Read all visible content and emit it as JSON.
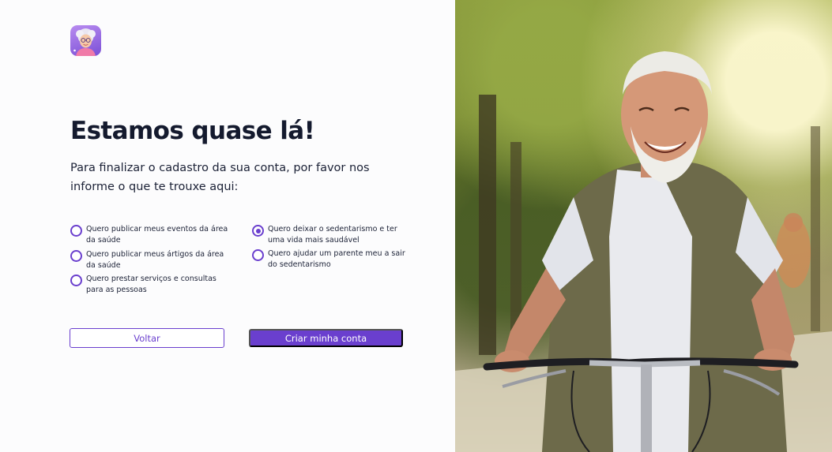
{
  "logo": {
    "icon": "elderly-woman-avatar-icon"
  },
  "heading": "Estamos quase lá!",
  "subtitle": "Para finalizar o cadastro da sua conta, por favor nos informe o que te trouxe aqui:",
  "options": [
    {
      "label": "Quero publicar meus eventos da área da saúde",
      "checked": false
    },
    {
      "label": "Quero publicar meus ártigos da área da saúde",
      "checked": false
    },
    {
      "label": "Quero prestar serviços e consultas para as pessoas",
      "checked": false
    },
    {
      "label": "Quero deixar o sedentarismo e ter uma vida mais saudável",
      "checked": true
    },
    {
      "label": "Quero ajudar um parente meu a sair do sedentarismo",
      "checked": false
    }
  ],
  "buttons": {
    "back": "Voltar",
    "create": "Criar minha conta"
  },
  "colors": {
    "accent": "#6a3fce",
    "heading": "#141a2e",
    "background": "#fcfcfd"
  }
}
